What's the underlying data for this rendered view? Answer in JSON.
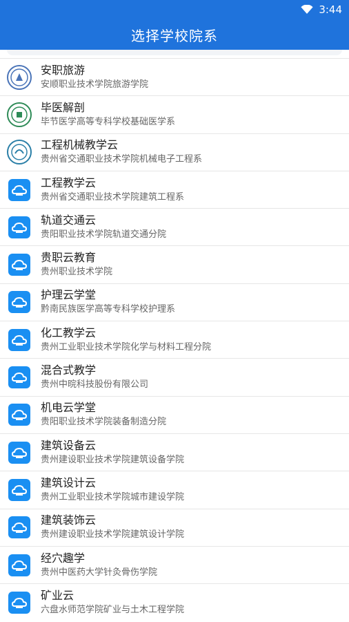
{
  "status": {
    "time": "3:44"
  },
  "header": {
    "title": "选择学校院系"
  },
  "items": [
    {
      "name": "安职旅游",
      "sub": "安顺职业技术学院旅游学院",
      "icon": "school-logo-icon"
    },
    {
      "name": "毕医解剖",
      "sub": "毕节医学高等专科学校基础医学系",
      "icon": "school-logo-icon"
    },
    {
      "name": "工程机械教学云",
      "sub": "贵州省交通职业技术学院机械电子工程系",
      "icon": "school-logo-icon"
    },
    {
      "name": "工程教学云",
      "sub": "贵州省交通职业技术学院建筑工程系",
      "icon": "cloud-icon"
    },
    {
      "name": "轨道交通云",
      "sub": "贵阳职业技术学院轨道交通分院",
      "icon": "cloud-icon"
    },
    {
      "name": "贵职云教育",
      "sub": "贵州职业技术学院",
      "icon": "cloud-icon"
    },
    {
      "name": "护理云学堂",
      "sub": "黔南民族医学高等专科学校护理系",
      "icon": "cloud-icon"
    },
    {
      "name": "化工教学云",
      "sub": "贵州工业职业技术学院化学与材料工程分院",
      "icon": "cloud-icon"
    },
    {
      "name": "混合式教学",
      "sub": "贵州中晥科技股份有限公司",
      "icon": "cloud-icon"
    },
    {
      "name": "机电云学堂",
      "sub": "贵阳职业技术学院装备制造分院",
      "icon": "cloud-icon"
    },
    {
      "name": "建筑设备云",
      "sub": "贵州建设职业技术学院建筑设备学院",
      "icon": "cloud-icon"
    },
    {
      "name": "建筑设计云",
      "sub": "贵州工业职业技术学院城市建设学院",
      "icon": "cloud-icon"
    },
    {
      "name": "建筑装饰云",
      "sub": "贵州建设职业技术学院建筑设计学院",
      "icon": "cloud-icon"
    },
    {
      "name": "经穴趣学",
      "sub": "贵州中医药大学针灸骨伤学院",
      "icon": "cloud-icon"
    },
    {
      "name": "矿业云",
      "sub": "六盘水师范学院矿业与土木工程学院",
      "icon": "cloud-icon"
    }
  ]
}
